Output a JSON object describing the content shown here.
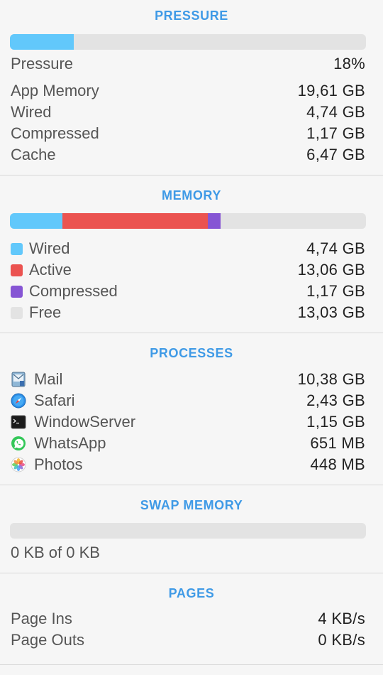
{
  "pressure": {
    "title": "PRESSURE",
    "bar_fraction": 0.18,
    "bar_color": "#62c8fb",
    "label": "Pressure",
    "value": "18%",
    "rows": [
      {
        "label": "App Memory",
        "value": "19,61 GB"
      },
      {
        "label": "Wired",
        "value": "4,74 GB"
      },
      {
        "label": "Compressed",
        "value": "1,17 GB"
      },
      {
        "label": "Cache",
        "value": "6,47 GB"
      }
    ]
  },
  "memory": {
    "title": "MEMORY",
    "segments": [
      {
        "name": "wired",
        "fraction": 0.1479,
        "color": "#62c8fb"
      },
      {
        "name": "active",
        "fraction": 0.4075,
        "color": "#eb5350"
      },
      {
        "name": "compressed",
        "fraction": 0.0365,
        "color": "#8655d4"
      },
      {
        "name": "free",
        "fraction": 0.4065,
        "color": "#e3e3e3"
      }
    ],
    "legend": [
      {
        "label": "Wired",
        "value": "4,74 GB",
        "color": "#62c8fb"
      },
      {
        "label": "Active",
        "value": "13,06 GB",
        "color": "#eb5350"
      },
      {
        "label": "Compressed",
        "value": "1,17 GB",
        "color": "#8655d4"
      },
      {
        "label": "Free",
        "value": "13,03 GB",
        "color": "#e3e3e3"
      }
    ]
  },
  "processes": {
    "title": "PROCESSES",
    "items": [
      {
        "name": "Mail",
        "value": "10,38 GB",
        "icon": "mail-icon"
      },
      {
        "name": "Safari",
        "value": "2,43 GB",
        "icon": "safari-icon"
      },
      {
        "name": "WindowServer",
        "value": "1,15 GB",
        "icon": "terminal-icon"
      },
      {
        "name": "WhatsApp",
        "value": "651 MB",
        "icon": "whatsapp-icon"
      },
      {
        "name": "Photos",
        "value": "448 MB",
        "icon": "photos-icon"
      }
    ]
  },
  "swap": {
    "title": "SWAP MEMORY",
    "bar_fraction": 0,
    "summary": "0 KB of 0 KB"
  },
  "pages": {
    "title": "PAGES",
    "rows": [
      {
        "label": "Page Ins",
        "value": "4 KB/s"
      },
      {
        "label": "Page Outs",
        "value": "0 KB/s"
      }
    ]
  }
}
